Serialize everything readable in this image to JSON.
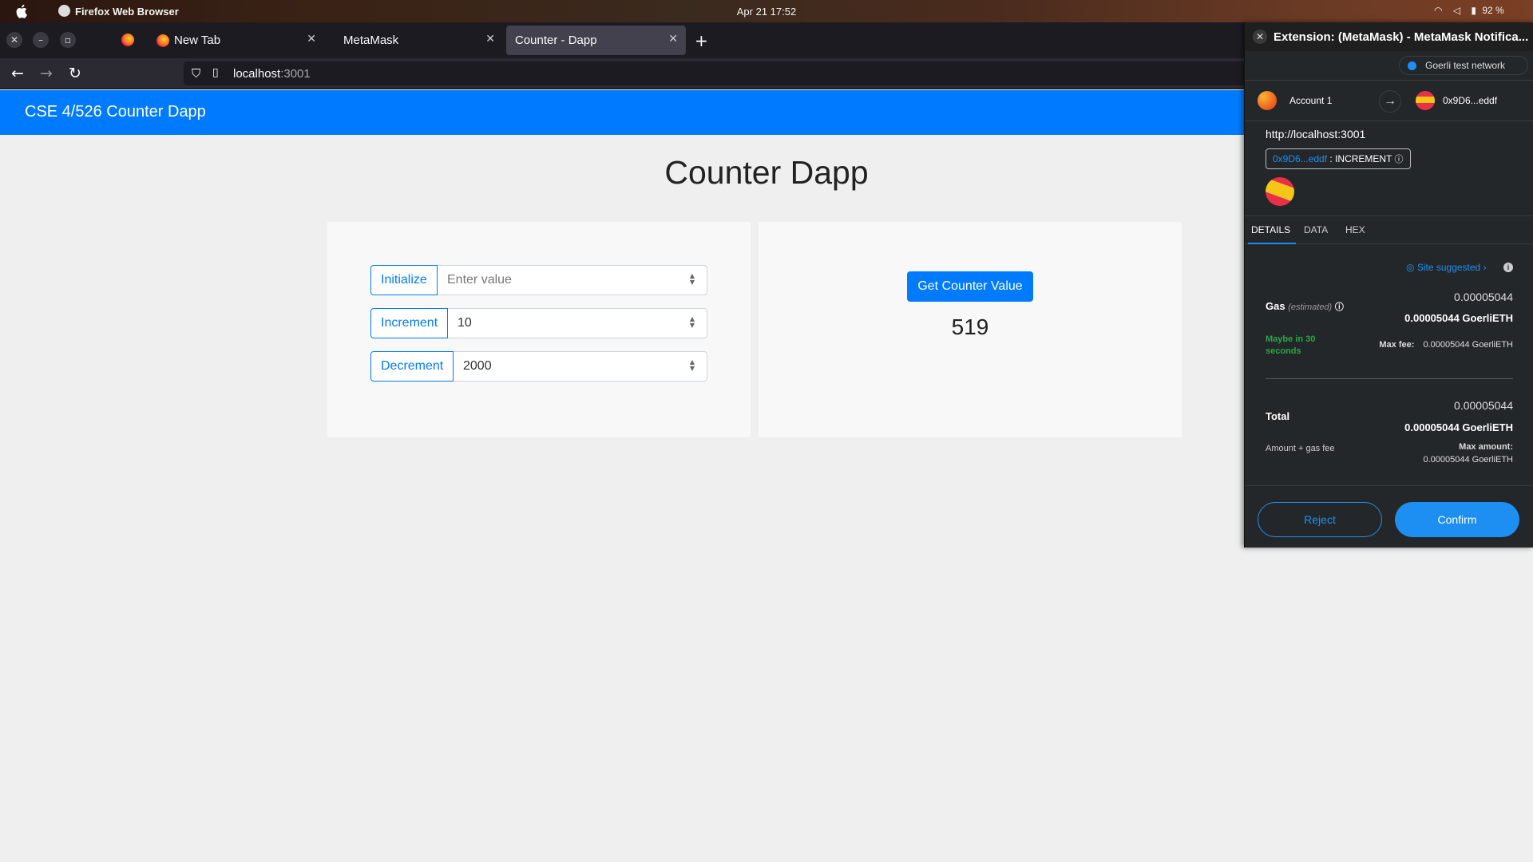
{
  "system": {
    "app_name": "Firefox Web Browser",
    "clock": "Apr 21  17:52",
    "battery": "92 %"
  },
  "browser": {
    "tabs": [
      {
        "label": "New Tab"
      },
      {
        "label": "MetaMask"
      },
      {
        "label": "Counter - Dapp",
        "active": true
      }
    ],
    "url_host": "localhost",
    "url_port": ":3001"
  },
  "dapp": {
    "brand": "CSE 4/526 Counter Dapp",
    "heading": "Counter Dapp",
    "initialize_label": "Initialize",
    "initialize_placeholder": "Enter value",
    "increment_label": "Increment",
    "increment_value": "10",
    "decrement_label": "Decrement",
    "decrement_value": "2000",
    "get_button": "Get Counter Value",
    "counter_value": "519",
    "accent_color": "#007bff"
  },
  "metamask": {
    "title": "Extension: (MetaMask) - MetaMask Notifica...",
    "network": "Goerli test network",
    "from_account": "Account 1",
    "to_address": "0x9D6...eddf",
    "origin": "http://localhost:3001",
    "method_address": "0x9D6...eddf",
    "method_sep": " : ",
    "method_name": "INCREMENT",
    "tabs": [
      "DETAILS",
      "DATA",
      "HEX"
    ],
    "site_suggested": "Site suggested",
    "gas_label": "Gas",
    "gas_estimated": "(estimated)",
    "gas_value": "0.00005044",
    "gas_value_eth": "0.00005044 GoerliETH",
    "gas_time": "Maybe in 30 seconds",
    "max_fee_label": "Max fee:",
    "max_fee_value": "0.00005044 GoerliETH",
    "total_label": "Total",
    "total_value": "0.00005044",
    "total_value_eth": "0.00005044 GoerliETH",
    "total_sub": "Amount + gas fee",
    "max_amount_label": "Max amount:",
    "max_amount_value": "0.00005044 GoerliETH",
    "reject_label": "Reject",
    "confirm_label": "Confirm",
    "accent_color": "#1e8ff2"
  }
}
